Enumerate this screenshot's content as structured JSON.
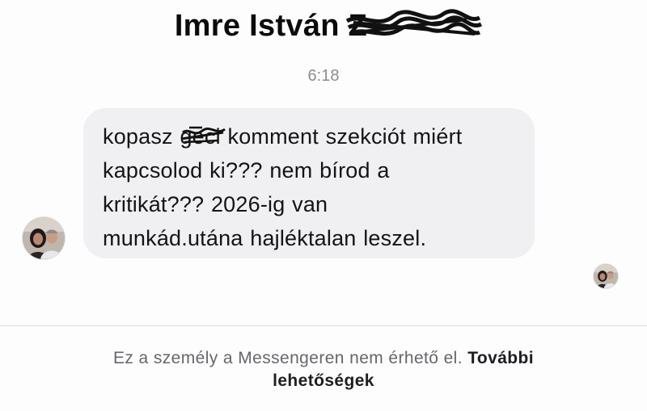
{
  "header": {
    "name_visible": "Imre István",
    "surname_redacted": "Z"
  },
  "conversation": {
    "timestamp": "6:18",
    "message": {
      "lines": [
        {
          "before": "kopasz ",
          "crossed": "geci",
          "after": " komment szekciót miért"
        },
        {
          "text": "kapcsolod ki??? nem bírod a"
        },
        {
          "text": "kritikát??? 2026-ig van"
        },
        {
          "text": "munkád.utána hajléktalan leszel."
        }
      ]
    }
  },
  "footer": {
    "notice_text": "Ez a személy a Messengeren nem érhető el.",
    "more_link_line1": "További",
    "more_link_line2": "lehetőségek"
  },
  "colors": {
    "bubble_background": "#f0f0f3",
    "secondary_text": "#65676b",
    "timestamp_text": "#8a8d91"
  },
  "icons": {
    "sender_avatar": "profile-photo-icon",
    "seen_receipt": "seen-avatar-icon"
  }
}
